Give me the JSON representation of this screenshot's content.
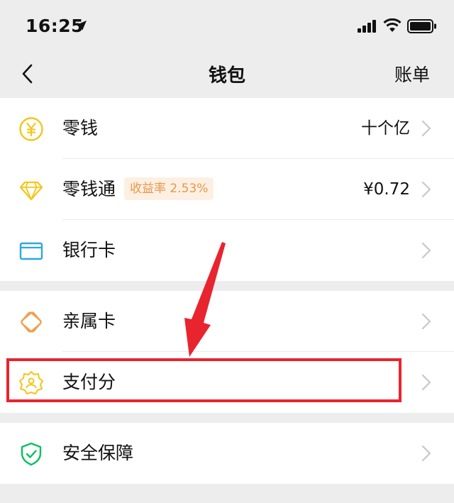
{
  "status_bar": {
    "time": "16:25",
    "icons": [
      "location-arrow-icon",
      "cellular-signal-icon",
      "wifi-icon",
      "battery-icon"
    ]
  },
  "nav": {
    "back_icon": "chevron-left-icon",
    "title": "钱包",
    "right_label": "账单"
  },
  "groups": [
    {
      "items": [
        {
          "label": "零钱",
          "value": "十个亿",
          "icon": "yuan-coin-icon",
          "icon_color": "#f5c518"
        },
        {
          "label": "零钱通",
          "badge": "收益率 2.53%",
          "value": "¥0.72",
          "icon": "diamond-icon",
          "icon_color": "#f5c518"
        },
        {
          "label": "银行卡",
          "value": "",
          "icon": "bank-card-icon",
          "icon_color": "#2ea7e0"
        }
      ]
    },
    {
      "items": [
        {
          "label": "亲属卡",
          "value": "",
          "icon": "family-card-icon",
          "icon_color": "#f0a04b"
        },
        {
          "label": "支付分",
          "value": "",
          "icon": "payscore-badge-icon",
          "icon_color": "#f5c518",
          "highlighted": true
        }
      ]
    },
    {
      "items": [
        {
          "label": "安全保障",
          "value": "",
          "icon": "security-shield-icon",
          "icon_color": "#07c160"
        }
      ]
    }
  ],
  "colors": {
    "background": "#ededed",
    "card": "#ffffff",
    "badge_bg": "#fdf0e2",
    "badge_text": "#e8974a",
    "annotation_red": "#e8242f",
    "chevron": "#c7c7cc"
  }
}
